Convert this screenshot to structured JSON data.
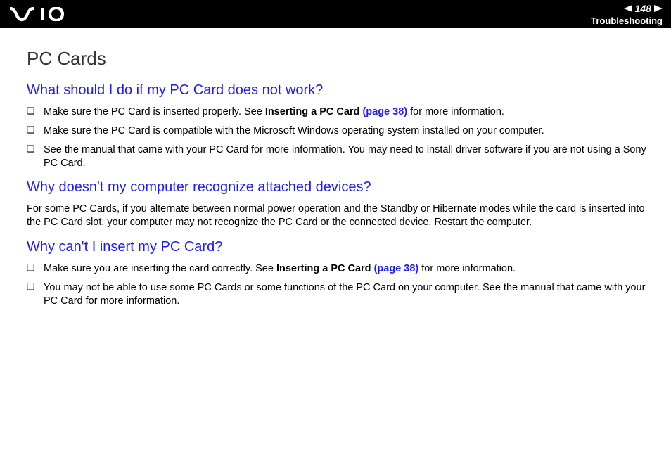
{
  "header": {
    "page_number": "148",
    "section": "Troubleshooting"
  },
  "main_title": "PC Cards",
  "q1": {
    "heading": "What should I do if my PC Card does not work?",
    "items": [
      {
        "pre": "Make sure the PC Card is inserted properly. See ",
        "bold": "Inserting a PC Card ",
        "link": "(page 38)",
        "post": " for more information."
      },
      {
        "pre": "Make sure the PC Card is compatible with the Microsoft Windows operating system installed on your computer.",
        "bold": "",
        "link": "",
        "post": ""
      },
      {
        "pre": "See the manual that came with your PC Card for more information. You may need to install driver software if you are not using a Sony PC Card.",
        "bold": "",
        "link": "",
        "post": ""
      }
    ]
  },
  "q2": {
    "heading": "Why doesn't my computer recognize attached devices?",
    "para": "For some PC Cards, if you alternate between normal power operation and the Standby or Hibernate modes while the card is inserted into the PC Card slot, your computer may not recognize the PC Card or the connected device. Restart the computer."
  },
  "q3": {
    "heading": "Why can't I insert my PC Card?",
    "items": [
      {
        "pre": "Make sure you are inserting the card correctly. See ",
        "bold": "Inserting a PC Card ",
        "link": "(page 38)",
        "post": " for more information."
      },
      {
        "pre": "You may not be able to use some PC Cards or some functions of the PC Card on your computer. See the manual that came with your PC Card for more information.",
        "bold": "",
        "link": "",
        "post": ""
      }
    ]
  }
}
